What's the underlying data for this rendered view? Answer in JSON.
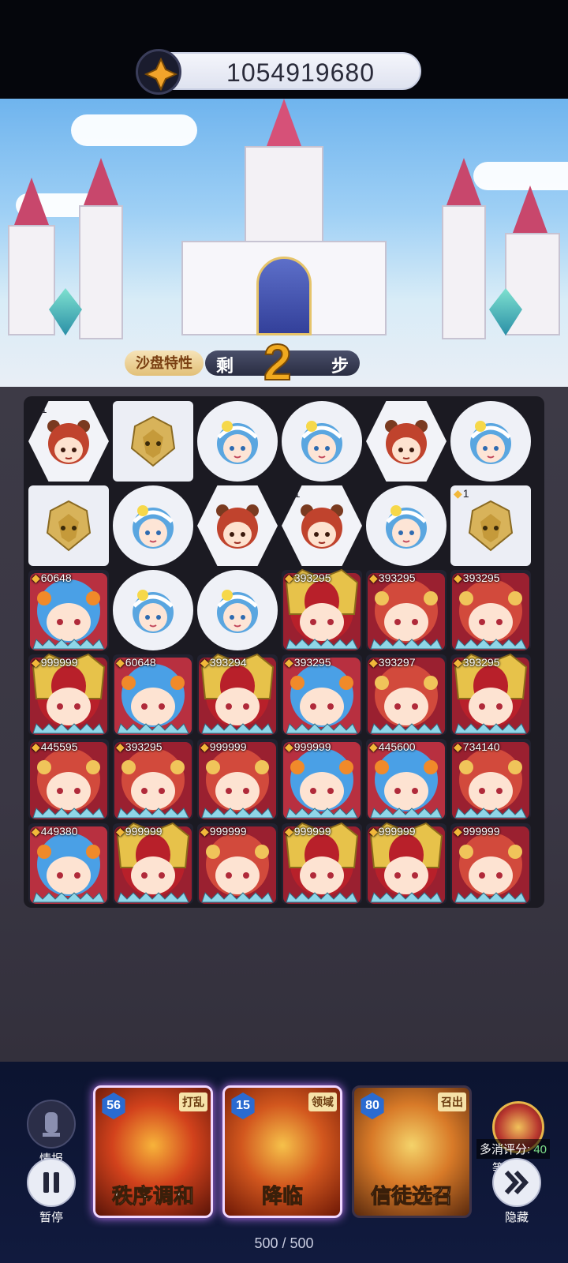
{
  "header": {
    "score": "1054919680",
    "score_icon": "star-gem-icon"
  },
  "scene": {
    "trait_label": "沙盘特性",
    "steps_prefix": "剩",
    "steps_value": "2",
    "steps_suffix": "步"
  },
  "board": {
    "rows": [
      [
        {
          "kind": "bear-head",
          "shape": "hex",
          "badge": "1"
        },
        {
          "kind": "lion-head",
          "shape": "square",
          "badge": ""
        },
        {
          "kind": "maid-head",
          "shape": "circle",
          "badge": ""
        },
        {
          "kind": "maid-head",
          "shape": "circle",
          "badge": ""
        },
        {
          "kind": "bear-head",
          "shape": "hex",
          "badge": ""
        },
        {
          "kind": "maid-head",
          "shape": "circle",
          "badge": ""
        }
      ],
      [
        {
          "kind": "lion-head",
          "shape": "square",
          "badge": ""
        },
        {
          "kind": "maid-head",
          "shape": "circle",
          "badge": ""
        },
        {
          "kind": "bear-head",
          "shape": "hex",
          "badge": ""
        },
        {
          "kind": "bear-head",
          "shape": "hex",
          "badge": "1"
        },
        {
          "kind": "maid-head",
          "shape": "circle",
          "badge": ""
        },
        {
          "kind": "lion-head",
          "shape": "square",
          "badge": "1"
        }
      ],
      [
        {
          "kind": "blue-hero",
          "shape": "hero",
          "badge": "60648"
        },
        {
          "kind": "maid-head",
          "shape": "circle",
          "badge": ""
        },
        {
          "kind": "maid-head",
          "shape": "circle",
          "badge": ""
        },
        {
          "kind": "gold-hero",
          "shape": "hero",
          "badge": "393295"
        },
        {
          "kind": "red-hero",
          "shape": "hero",
          "badge": "393295"
        },
        {
          "kind": "red-hero",
          "shape": "hero",
          "badge": "393295"
        }
      ],
      [
        {
          "kind": "gold-hero",
          "shape": "hero",
          "badge": "999999"
        },
        {
          "kind": "blue-hero",
          "shape": "hero",
          "badge": "60648"
        },
        {
          "kind": "gold-hero",
          "shape": "hero",
          "badge": "393294"
        },
        {
          "kind": "blue-hero",
          "shape": "hero",
          "badge": "393295"
        },
        {
          "kind": "red-hero",
          "shape": "hero",
          "badge": "393297"
        },
        {
          "kind": "gold-hero",
          "shape": "hero",
          "badge": "393295"
        }
      ],
      [
        {
          "kind": "red-hero",
          "shape": "hero",
          "badge": "445595"
        },
        {
          "kind": "red-hero",
          "shape": "hero",
          "badge": "393295"
        },
        {
          "kind": "red-hero",
          "shape": "hero",
          "badge": "999999"
        },
        {
          "kind": "blue-hero",
          "shape": "hero",
          "badge": "999999"
        },
        {
          "kind": "blue-hero",
          "shape": "hero",
          "badge": "445600"
        },
        {
          "kind": "red-hero",
          "shape": "hero",
          "badge": "734140"
        }
      ],
      [
        {
          "kind": "blue-hero",
          "shape": "hero",
          "badge": "449380"
        },
        {
          "kind": "gold-hero",
          "shape": "hero",
          "badge": "999999"
        },
        {
          "kind": "red-hero",
          "shape": "hero",
          "badge": "999999"
        },
        {
          "kind": "gold-hero",
          "shape": "hero",
          "badge": "999999"
        },
        {
          "kind": "gold-hero",
          "shape": "hero",
          "badge": "999999"
        },
        {
          "kind": "red-hero",
          "shape": "hero",
          "badge": "999999"
        }
      ]
    ]
  },
  "bottom": {
    "intel_label": "情报",
    "pause_label": "暂停",
    "hide_label": "隐藏",
    "cards": [
      {
        "cost": "56",
        "tag": "打乱",
        "name": "秩序调和",
        "selected": true,
        "colors": [
          "#f7b33a",
          "#d2421c",
          "#5a1408"
        ]
      },
      {
        "cost": "15",
        "tag": "领域",
        "name": "降临",
        "selected": true,
        "colors": [
          "#f6c14a",
          "#d2571e",
          "#6e1806"
        ]
      },
      {
        "cost": "80",
        "tag": "召出",
        "name": "信徒选召",
        "selected": false,
        "colors": [
          "#f4d36a",
          "#d87a28",
          "#5a2a0e"
        ]
      }
    ],
    "energy": "500 / 500",
    "multi_score_label": "多消评分:",
    "multi_score_value": "40",
    "level": "等级40"
  }
}
